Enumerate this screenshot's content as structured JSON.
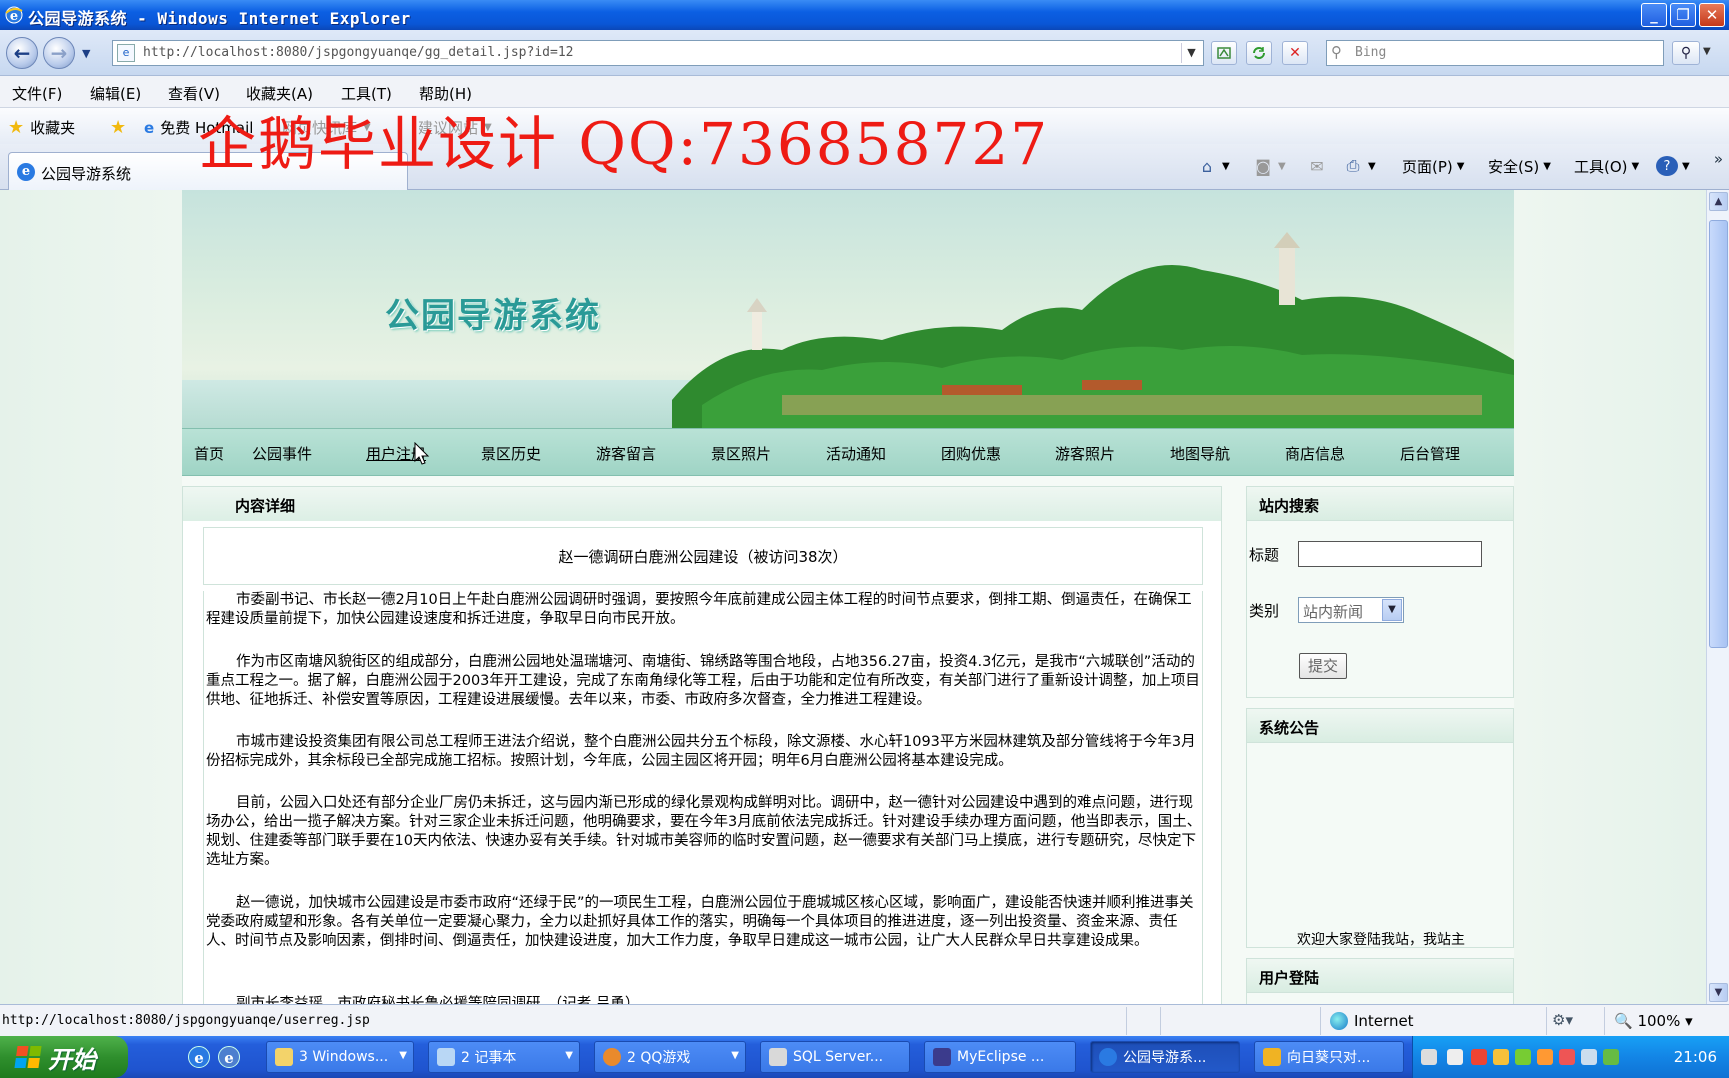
{
  "window": {
    "title": "公园导游系统 - Windows Internet Explorer",
    "controls": [
      "minimize",
      "restore",
      "close"
    ]
  },
  "addressbar": {
    "url": "http://localhost:8080/jspgongyuanqe/gg_detail.jsp?id=12",
    "search_placeholder": "Bing"
  },
  "menu": [
    "文件(F)",
    "编辑(E)",
    "查看(V)",
    "收藏夹(A)",
    "工具(T)",
    "帮助(H)"
  ],
  "favorites": {
    "label": "收藏夹",
    "items": [
      "免费 Hotmail",
      "网页快讯库",
      "建议网站"
    ]
  },
  "tab": {
    "title": "公园导游系统"
  },
  "commands": {
    "page": "页面(P)",
    "safety": "安全(S)",
    "tools": "工具(O)"
  },
  "watermark": "企鹅毕业设计 QQ:736858727",
  "site": {
    "title": "公园导游系统",
    "nav": [
      "首页",
      "公园事件",
      "用户注册",
      "景区历史",
      "游客留言",
      "景区照片",
      "活动通知",
      "团购优惠",
      "游客照片",
      "地图导航",
      "商店信息",
      "后台管理"
    ],
    "active_nav": "用户注册"
  },
  "content": {
    "header": "内容详细",
    "article_title": "赵一德调研白鹿洲公园建设（被访问38次）",
    "paragraphs": [
      "市委副书记、市长赵一德2月10日上午赴白鹿洲公园调研时强调，要按照今年底前建成公园主体工程的时间节点要求，倒排工期、倒逼责任，在确保工程建设质量前提下，加快公园建设速度和拆迁进度，争取早日向市民开放。",
      "作为市区南塘风貌街区的组成部分，白鹿洲公园地处温瑞塘河、南塘街、锦绣路等围合地段，占地356.27亩，投资4.3亿元，是我市“六城联创”活动的重点工程之一。据了解，白鹿洲公园于2003年开工建设，完成了东南角绿化等工程，后由于功能和定位有所改变，有关部门进行了重新设计调整，加上项目供地、征地拆迁、补偿安置等原因，工程建设进展缓慢。去年以来，市委、市政府多次督查，全力推进工程建设。",
      "市城市建设投资集团有限公司总工程师王进法介绍说，整个白鹿洲公园共分五个标段，除文源楼、水心轩1093平方米园林建筑及部分管线将于今年3月份招标完成外，其余标段已全部完成施工招标。按照计划，今年底，公园主园区将开园；明年6月白鹿洲公园将基本建设完成。",
      "目前，公园入口处还有部分企业厂房仍未拆迁，这与园内渐已形成的绿化景观构成鲜明对比。调研中，赵一德针对公园建设中遇到的难点问题，进行现场办公，给出一揽子解决方案。针对三家企业未拆迁问题，他明确要求，要在今年3月底前依法完成拆迁。针对建设手续办理方面问题，他当即表示，国土、规划、住建委等部门联手要在10天内依法、快速办妥有关手续。针对城市美容师的临时安置问题，赵一德要求有关部门马上摸底，进行专题研究，尽快定下选址方案。",
      "赵一德说，加快城市公园建设是市委市政府“还绿于民”的一项民生工程，白鹿洲公园位于鹿城城区核心区域，影响面广，建设能否快速并顺利推进事关党委政府威望和形象。各有关单位一定要凝心聚力，全力以赴抓好具体工作的落实，明确每一个具体项目的推进进度，逐一列出投资量、资金来源、责任人、时间节点及影响因素，倒排时间、倒逼责任，加快建设进度，加大工作力度，争取早日建成这一城市公园，让广大人民群众早日共享建设成果。",
      "副市长李益瑶、市政府秘书长鲁必援等陪同调研。（记者 吕勇）"
    ]
  },
  "sidebar": {
    "search": {
      "header": "站内搜索",
      "title_label": "标题",
      "title_value": "",
      "category_label": "类别",
      "category_selected": "站内新闻",
      "submit": "提交"
    },
    "notice": {
      "header": "系统公告",
      "text": "欢迎大家登陆我站，我站主"
    },
    "login": {
      "header": "用户登陆"
    }
  },
  "statusbar": {
    "url": "http://localhost:8080/jspgongyuanqe/userreg.jsp",
    "zone": "Internet",
    "zoom": "100%"
  },
  "taskbar": {
    "start": "开始",
    "tasks": [
      "3 Windows...",
      "2 记事本",
      "2 QQ游戏",
      "SQL Server...",
      "MyEclipse ...",
      "公园导游系...",
      "向日葵只对..."
    ],
    "active_task": "公园导游系...",
    "clock": "21:06"
  },
  "colors": {
    "ie_titlebar": "#0b5fe3",
    "site_nav": "#a9d9cb",
    "site_title": "#2a9a97",
    "watermark": "#ee1b14",
    "taskbar": "#245edb",
    "start_button": "#2f8f2d"
  }
}
